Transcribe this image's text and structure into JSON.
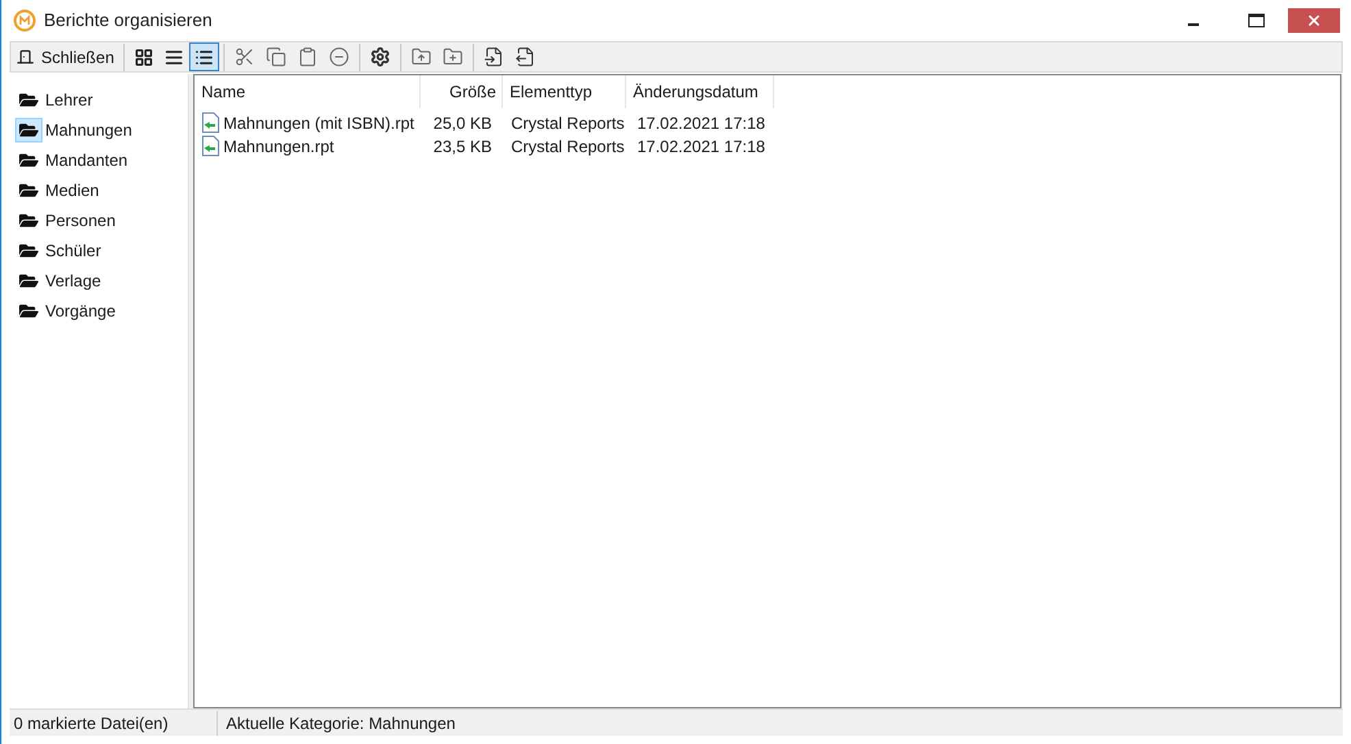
{
  "window": {
    "title": "Berichte organisieren"
  },
  "toolbar": {
    "close_label": "Schließen",
    "view_modes": [
      {
        "kind": "tiles",
        "selected": false
      },
      {
        "kind": "list",
        "selected": false
      },
      {
        "kind": "details",
        "selected": true
      }
    ],
    "tool_groups": [
      [
        {
          "kind": "cut"
        },
        {
          "kind": "copy"
        },
        {
          "kind": "paste"
        },
        {
          "kind": "remove"
        }
      ],
      [
        {
          "kind": "settings"
        }
      ],
      [
        {
          "kind": "folder-up"
        },
        {
          "kind": "folder-add"
        }
      ],
      [
        {
          "kind": "file-import"
        },
        {
          "kind": "file-export"
        }
      ]
    ]
  },
  "sidebar": {
    "items": [
      {
        "label": "Lehrer",
        "selected": false
      },
      {
        "label": "Mahnungen",
        "selected": true
      },
      {
        "label": "Mandanten",
        "selected": false
      },
      {
        "label": "Medien",
        "selected": false
      },
      {
        "label": "Personen",
        "selected": false
      },
      {
        "label": "Schüler",
        "selected": false
      },
      {
        "label": "Verlage",
        "selected": false
      },
      {
        "label": "Vorgänge",
        "selected": false
      }
    ]
  },
  "table": {
    "columns": [
      "Name",
      "Größe",
      "Elementtyp",
      "Änderungsdatum"
    ],
    "rows": [
      {
        "name": "Mahnungen (mit ISBN).rpt",
        "size": "25,0 KB",
        "type": "Crystal Reports",
        "date": "17.02.2021 17:18"
      },
      {
        "name": "Mahnungen.rpt",
        "size": "23,5 KB",
        "type": "Crystal Reports",
        "date": "17.02.2021 17:18"
      }
    ]
  },
  "status_bar": {
    "selection": "0 markierte Datei(en)",
    "category": "Aktuelle Kategorie: Mahnungen"
  }
}
